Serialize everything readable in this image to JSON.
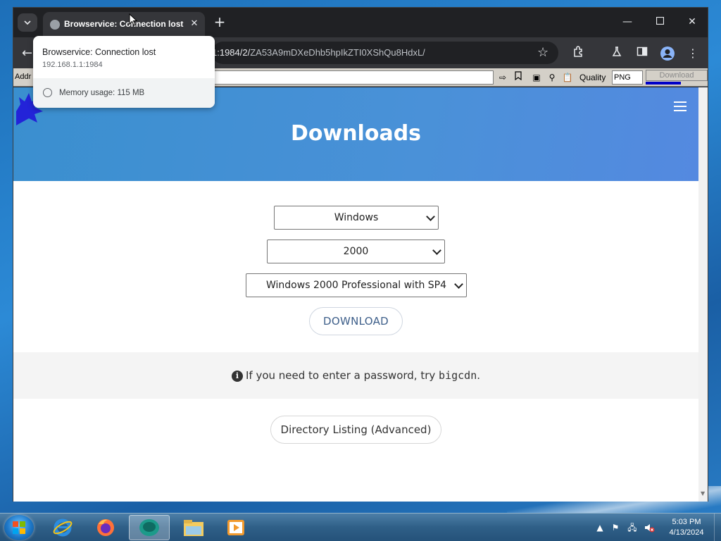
{
  "browser": {
    "tab_title": "Browservice: Connection lost",
    "url_prefix": "1:1984/2/",
    "url_rest": "ZA53A9mDXeDhb5hpIkZTI0XShQu8HdxL/",
    "legacy_bar": {
      "address_label": "Addr",
      "quality_label": "Quality",
      "quality_value": "PNG",
      "download_label": "Download"
    },
    "hover_card": {
      "title": "Browservice: Connection lost",
      "url": "192.168.1.1:1984",
      "memory": "Memory usage: 115 MB"
    }
  },
  "page": {
    "title": "Downloads",
    "os_select": "Windows",
    "version_select": "2000",
    "edition_select": "Windows 2000 Professional with SP4",
    "download_button": "DOWNLOAD",
    "notice_prefix": "If you need to enter a password, try",
    "notice_code": "bigcdn",
    "notice_suffix": ".",
    "directory_button": "Directory Listing (Advanced)"
  },
  "taskbar": {
    "time": "5:03 PM",
    "date": "4/13/2024"
  },
  "colors": {
    "hero_start": "#3a8fcf",
    "hero_end": "#5489e0",
    "download_text": "#3e5f8a"
  }
}
